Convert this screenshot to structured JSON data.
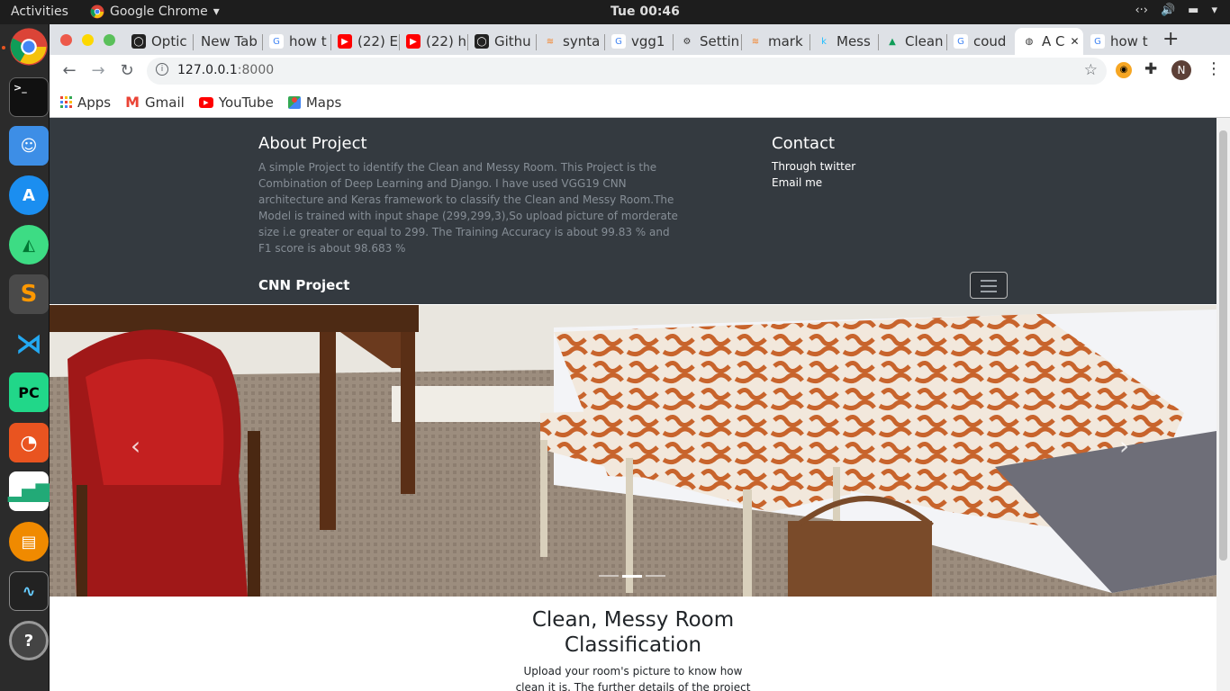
{
  "topbar": {
    "activities": "Activities",
    "app_name": "Google Chrome",
    "clock": "Tue 00:46"
  },
  "dock": {
    "items": [
      "chrome-icon",
      "terminal-icon",
      "finder-icon",
      "app-store-icon",
      "android-studio-icon",
      "sublime-text-icon",
      "vscode-icon",
      "pycharm-icon",
      "ubuntu-software-icon",
      "charts-icon",
      "books-icon",
      "system-monitor-icon",
      "help-icon"
    ]
  },
  "tabs": [
    {
      "label": "Optic",
      "icon": "github-icon"
    },
    {
      "label": "New Tab",
      "icon": ""
    },
    {
      "label": "how t",
      "icon": "google-icon"
    },
    {
      "label": "(22) E",
      "icon": "youtube-icon"
    },
    {
      "label": "(22) h",
      "icon": "youtube-icon"
    },
    {
      "label": "Githu",
      "icon": "github-icon"
    },
    {
      "label": "synta",
      "icon": "stackoverflow-icon"
    },
    {
      "label": "vgg1",
      "icon": "google-icon"
    },
    {
      "label": "Settin",
      "icon": "gear-icon"
    },
    {
      "label": "mark",
      "icon": "stackoverflow-icon"
    },
    {
      "label": "Mess",
      "icon": "kaggle-icon"
    },
    {
      "label": "Clean",
      "icon": "drive-icon"
    },
    {
      "label": "coud",
      "icon": "google-icon"
    },
    {
      "label": "A C",
      "icon": "globe-icon"
    },
    {
      "label": "how t",
      "icon": "google-icon"
    }
  ],
  "address_bar": {
    "host": "127.0.0.1",
    "port": ":8000"
  },
  "bookmarks": [
    {
      "label": "Apps",
      "icon": "apps-grid-icon"
    },
    {
      "label": "Gmail",
      "icon": "gmail-icon"
    },
    {
      "label": "YouTube",
      "icon": "youtube-icon"
    },
    {
      "label": "Maps",
      "icon": "maps-icon"
    }
  ],
  "profile_initial": "N",
  "site": {
    "about_title": "About Project",
    "about_text": "A simple Project to identify the Clean and Messy Room. This Project is the Combination of Deep Learning and Django. I have used VGG19 CNN architecture and Keras framework to classify the Clean and Messy Room.The Model is trained with input shape (299,299,3),So upload picture of morderate size i.e greater or equal to 299. The Training Accuracy is about 99.83 % and F1 score is about 98.683 %",
    "contact_title": "Contact",
    "contact_links": [
      "Through twitter",
      "Email me"
    ],
    "brand": "CNN Project",
    "hero_title": "Clean, Messy Room Classification",
    "hero_text": "Upload your room's picture to know how clean it is. The further details of the project is present at",
    "carousel_active_index": 2,
    "carousel_count": 3
  }
}
